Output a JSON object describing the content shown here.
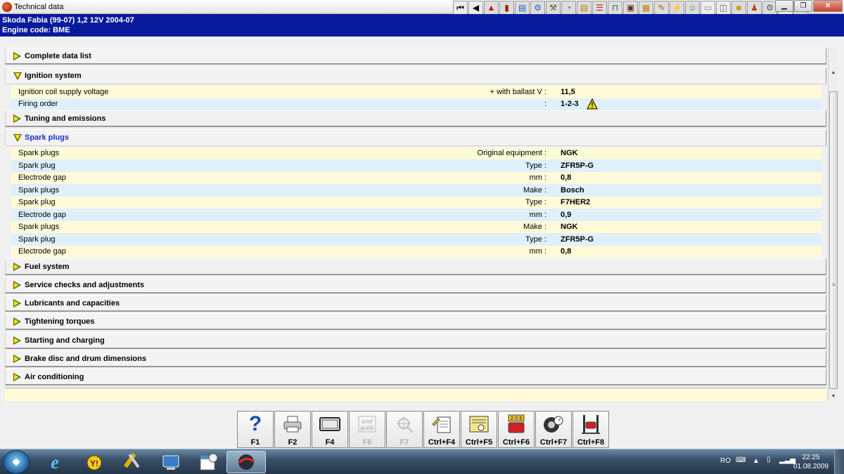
{
  "window": {
    "title": "Technical data"
  },
  "header": {
    "vehicle": "Skoda   Fabia (99-07) 1,2 12V 2004-07",
    "engine_code": "Engine code: BME"
  },
  "sections": {
    "complete": "Complete data list",
    "ignition": "Ignition system",
    "tuning": "Tuning and emissions",
    "spark": "Spark plugs",
    "fuel": "Fuel system",
    "service": "Service checks and adjustments",
    "lubricants": "Lubricants and capacities",
    "torques": "Tightening torques",
    "starting": "Starting and charging",
    "brake": "Brake disc and drum dimensions",
    "aircon": "Air conditioning"
  },
  "ignition_rows": [
    {
      "label": "Ignition coil supply voltage",
      "unit": "+ with ballast  V :",
      "value": "11,5"
    },
    {
      "label": "Firing order",
      "unit": ":",
      "value": "1-2-3"
    }
  ],
  "spark_rows": [
    {
      "label": "Spark plugs",
      "unit": "Original equipment :",
      "value": "NGK"
    },
    {
      "label": "Spark plug",
      "unit": "Type :",
      "value": "ZFR5P-G"
    },
    {
      "label": "Electrode gap",
      "unit": "mm :",
      "value": "0,8"
    },
    {
      "label": "Spark plugs",
      "unit": "Make :",
      "value": "Bosch"
    },
    {
      "label": "Spark plug",
      "unit": "Type :",
      "value": "F7HER2"
    },
    {
      "label": "Electrode gap",
      "unit": "mm :",
      "value": "0,9"
    },
    {
      "label": "Spark plugs",
      "unit": "Make :",
      "value": "NGK"
    },
    {
      "label": "Spark plug",
      "unit": "Type :",
      "value": "ZFR5P-G"
    },
    {
      "label": "Electrode gap",
      "unit": "mm :",
      "value": "0,8"
    }
  ],
  "fkeys": [
    {
      "label": "F1",
      "icon": "help-icon",
      "glyph": "?"
    },
    {
      "label": "F2",
      "icon": "printer-icon",
      "glyph": "🖶"
    },
    {
      "label": "F4",
      "icon": "screen-icon",
      "glyph": "▭"
    },
    {
      "label": "F6",
      "icon": "brief-grafikim-icon",
      "glyph": "▦"
    },
    {
      "label": "F7",
      "icon": "crosshair-icon",
      "glyph": "⌖"
    },
    {
      "label": "Ctrl+F4",
      "icon": "notes-icon",
      "glyph": "✎"
    },
    {
      "label": "Ctrl+F5",
      "icon": "select-icon",
      "glyph": "☟"
    },
    {
      "label": "Ctrl+F6",
      "icon": "engine-icon",
      "glyph": "▣"
    },
    {
      "label": "Ctrl+F7",
      "icon": "tyre-icon",
      "glyph": "◍"
    },
    {
      "label": "Ctrl+F8",
      "icon": "lift-icon",
      "glyph": "⊓"
    }
  ],
  "tray": {
    "language": "RO",
    "time": "22:25",
    "date": "01.08.2009"
  },
  "colors": {
    "header_bg": "#0a1a9c",
    "row_yellow": "#fffbd8",
    "row_blue": "#dff0fb",
    "active_section_text": "#1a2ccc"
  }
}
